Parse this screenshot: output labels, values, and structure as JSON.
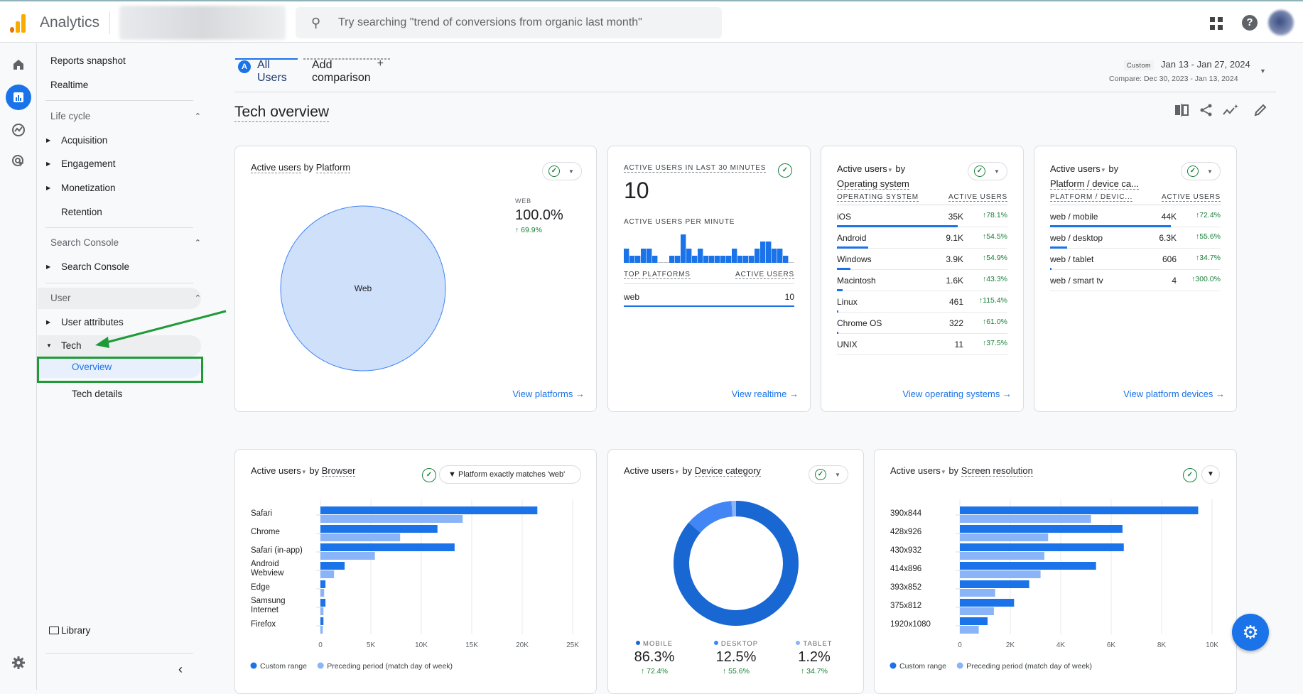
{
  "app": {
    "name": "Analytics",
    "search_placeholder": "Try searching \"trend of conversions from organic last month\""
  },
  "topbar_icons": [
    "apps-grid-icon",
    "help-icon",
    "avatar"
  ],
  "rail": [
    "home-icon",
    "reports-icon",
    "explore-icon",
    "advertising-icon",
    "settings-icon"
  ],
  "sidebar": {
    "reports_snapshot": "Reports snapshot",
    "realtime": "Realtime",
    "lifecycle": {
      "header": "Life cycle",
      "items": [
        "Acquisition",
        "Engagement",
        "Monetization",
        "Retention"
      ]
    },
    "search_console": {
      "header": "Search Console",
      "items": [
        "Search Console"
      ]
    },
    "user": {
      "header": "User",
      "items": [
        "User attributes",
        "Tech"
      ],
      "sub_items": [
        "Overview",
        "Tech details"
      ]
    },
    "library": "Library"
  },
  "comparison": {
    "segment_letter": "A",
    "segment": "All Users",
    "add": "Add comparison"
  },
  "date": {
    "badge": "Custom",
    "range": "Jan 13 - Jan 27, 2024",
    "compare": "Compare: Dec 30, 2023 - Jan 13, 2024"
  },
  "page": {
    "title": "Tech overview"
  },
  "toolbar": [
    "compare-icon",
    "share-icon",
    "insights-icon",
    "edit-icon"
  ],
  "platform_card": {
    "title_metric": "Active users",
    "title_by": "by",
    "title_dim": "Platform",
    "pie_label": "Web",
    "legend_label": "WEB",
    "legend_value": "100.0%",
    "legend_change": "↑ 69.9%",
    "link": "View platforms"
  },
  "realtime_card": {
    "title": "ACTIVE USERS IN LAST 30 MINUTES",
    "value": "10",
    "per_minute_title": "ACTIVE USERS PER MINUTE",
    "per_minute": [
      2,
      1,
      1,
      2,
      2,
      1,
      0,
      0,
      1,
      1,
      4,
      2,
      1,
      2,
      1,
      1,
      1,
      1,
      1,
      2,
      1,
      1,
      1,
      2,
      3,
      3,
      2,
      2,
      1,
      0
    ],
    "col1": "TOP PLATFORMS",
    "col2": "ACTIVE USERS",
    "rows": [
      {
        "name": "web",
        "value": "10"
      }
    ],
    "link": "View realtime"
  },
  "os_card": {
    "title_metric": "Active users",
    "title_by": "by",
    "title_dim": "Operating system",
    "col1": "OPERATING SYSTEM",
    "col2": "ACTIVE USERS",
    "rows": [
      {
        "name": "iOS",
        "value": "35K",
        "change": "↑78.1%",
        "share": 1.0
      },
      {
        "name": "Android",
        "value": "9.1K",
        "change": "↑54.5%",
        "share": 0.26
      },
      {
        "name": "Windows",
        "value": "3.9K",
        "change": "↑54.9%",
        "share": 0.11
      },
      {
        "name": "Macintosh",
        "value": "1.6K",
        "change": "↑43.3%",
        "share": 0.045
      },
      {
        "name": "Linux",
        "value": "461",
        "change": "↑115.4%",
        "share": 0.013
      },
      {
        "name": "Chrome OS",
        "value": "322",
        "change": "↑61.0%",
        "share": 0.009
      },
      {
        "name": "UNIX",
        "value": "11",
        "change": "↑37.5%",
        "share": 0.0
      }
    ],
    "link": "View operating systems"
  },
  "device_table_card": {
    "title_metric": "Active users",
    "title_by": "by",
    "title_dim": "Platform / device ca...",
    "col1": "PLATFORM / DEVIC...",
    "col2": "ACTIVE USERS",
    "rows": [
      {
        "name": "web / mobile",
        "value": "44K",
        "change": "↑72.4%",
        "share": 1.0
      },
      {
        "name": "web / desktop",
        "value": "6.3K",
        "change": "↑55.6%",
        "share": 0.14
      },
      {
        "name": "web / tablet",
        "value": "606",
        "change": "↑34.7%",
        "share": 0.014
      },
      {
        "name": "web / smart tv",
        "value": "4",
        "change": "↑300.0%",
        "share": 0.0
      }
    ],
    "link": "View platform devices"
  },
  "browser_card": {
    "title_metric": "Active users",
    "title_by": "by",
    "title_dim": "Browser",
    "filter": "Platform exactly matches 'web'"
  },
  "device_card": {
    "title_metric": "Active users",
    "title_by": "by",
    "title_dim": "Device category",
    "legend": [
      {
        "label": "MOBILE",
        "pct": "86.3%",
        "change": "↑ 72.4%",
        "color": "#1967d2"
      },
      {
        "label": "DESKTOP",
        "pct": "12.5%",
        "change": "↑ 55.6%",
        "color": "#4285f4"
      },
      {
        "label": "TABLET",
        "pct": "1.2%",
        "change": "↑ 34.7%",
        "color": "#8ab4f8"
      }
    ]
  },
  "screen_card": {
    "title_metric": "Active users",
    "title_by": "by",
    "title_dim": "Screen resolution"
  },
  "chart_data": [
    {
      "type": "pie",
      "title": "Active users by Platform",
      "categories": [
        "Web"
      ],
      "values": [
        100.0
      ]
    },
    {
      "type": "bar",
      "title": "Active users per minute",
      "categories": [],
      "values": [
        2,
        1,
        1,
        2,
        2,
        1,
        0,
        0,
        1,
        1,
        4,
        2,
        1,
        2,
        1,
        1,
        1,
        1,
        1,
        2,
        1,
        1,
        1,
        2,
        3,
        3,
        2,
        2,
        1,
        0
      ]
    },
    {
      "type": "bar",
      "orientation": "horizontal",
      "title": "Active users by Browser",
      "categories": [
        "Safari",
        "Chrome",
        "Safari (in-app)",
        "Android Webview",
        "Edge",
        "Samsung Internet",
        "Firefox"
      ],
      "series": [
        {
          "name": "Custom range",
          "color": "#1a73e8",
          "values": [
            21500,
            11600,
            13300,
            2400,
            500,
            500,
            300
          ]
        },
        {
          "name": "Preceding period (match day of week)",
          "color": "#8ab4f8",
          "values": [
            14100,
            7900,
            5400,
            1350,
            370,
            300,
            230
          ]
        }
      ],
      "xlim": [
        0,
        25000
      ],
      "xticks": [
        "0",
        "5K",
        "10K",
        "15K",
        "20K",
        "25K"
      ],
      "grid": true,
      "legend": "bottom-left"
    },
    {
      "type": "pie",
      "donut": true,
      "title": "Active users by Device category",
      "categories": [
        "Mobile",
        "Desktop",
        "Tablet"
      ],
      "values": [
        86.3,
        12.5,
        1.2
      ]
    },
    {
      "type": "bar",
      "orientation": "horizontal",
      "title": "Active users by Screen resolution",
      "categories": [
        "390x844",
        "428x926",
        "430x932",
        "414x896",
        "393x852",
        "375x812",
        "1920x1080"
      ],
      "series": [
        {
          "name": "Custom range",
          "color": "#1a73e8",
          "values": [
            9450,
            6450,
            6500,
            5400,
            2750,
            2150,
            1100
          ]
        },
        {
          "name": "Preceding period (match day of week)",
          "color": "#8ab4f8",
          "values": [
            5200,
            3500,
            3350,
            3200,
            1400,
            1350,
            750
          ]
        }
      ],
      "xlim": [
        0,
        10000
      ],
      "xticks": [
        "0",
        "2K",
        "4K",
        "6K",
        "8K",
        "10K"
      ],
      "grid": true,
      "legend": "bottom-left"
    }
  ]
}
